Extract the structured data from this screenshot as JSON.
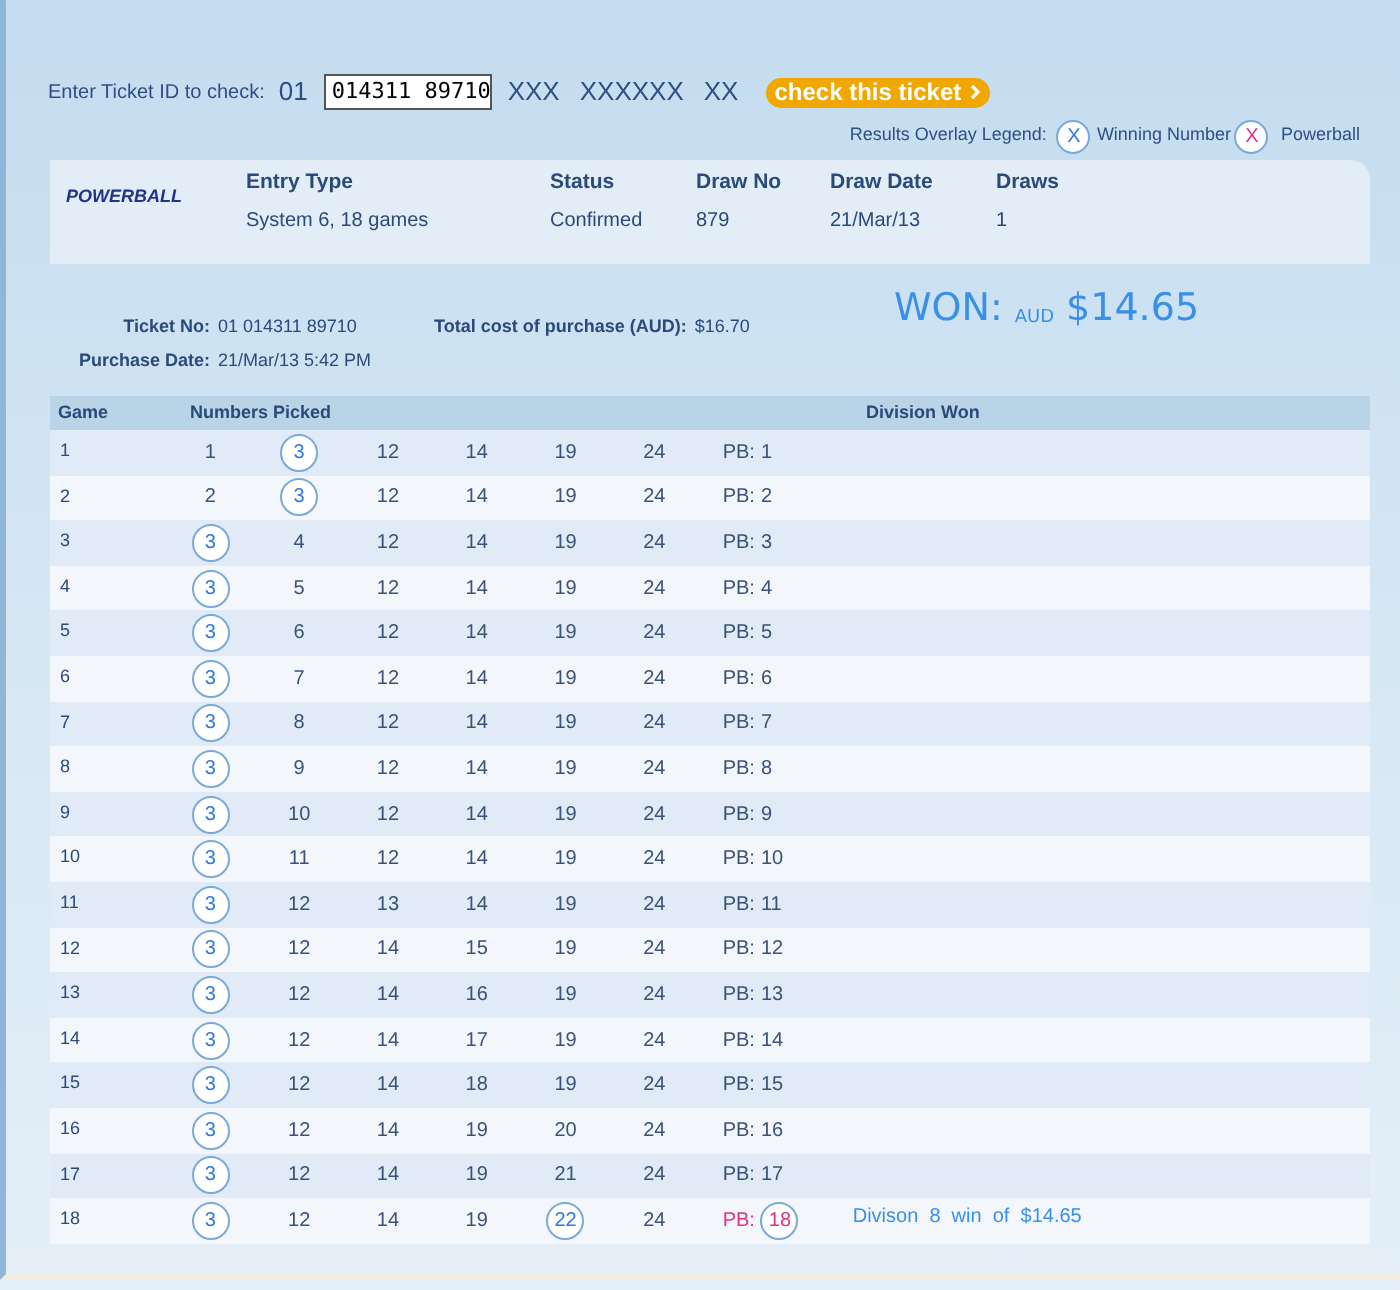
{
  "check_bar": {
    "label": "Enter Ticket ID to check:",
    "prefix": "01",
    "ticket_id": "014311 89710",
    "mask_1": "XXX",
    "mask_2": "XXXXXX",
    "mask_3": "XX",
    "button": "check this ticket"
  },
  "legend": {
    "label": "Results Overlay Legend:",
    "winning_symbol": "X",
    "winning_label": "Winning Number",
    "powerball_symbol": "X",
    "powerball_label": "Powerball"
  },
  "entry": {
    "logo": "POWERBALL",
    "fields": [
      {
        "label": "Entry Type",
        "value": "System 6, 18 games"
      },
      {
        "label": "Status",
        "value": "Confirmed"
      },
      {
        "label": "Draw No",
        "value": "879"
      },
      {
        "label": "Draw Date",
        "value": "21/Mar/13"
      },
      {
        "label": "Draws",
        "value": "1"
      }
    ]
  },
  "ticket": {
    "ticket_no_label": "Ticket No:",
    "ticket_no": "01 014311 89710",
    "purchase_date_label": "Purchase Date:",
    "purchase_date": "21/Mar/13 5:42 PM",
    "cost_label": "Total cost of purchase (AUD):",
    "cost": "$16.70",
    "won_label": "WON:",
    "won_currency": "AUD",
    "won_amount": "$14.65"
  },
  "table": {
    "columns": [
      "Game",
      "Numbers Picked",
      "Division Won"
    ],
    "rows": [
      {
        "game": "1",
        "numbers": [
          {
            "n": "1",
            "matched": false
          },
          {
            "n": "3",
            "matched": true
          },
          {
            "n": "12",
            "matched": false
          },
          {
            "n": "14",
            "matched": false
          },
          {
            "n": "19",
            "matched": false
          },
          {
            "n": "24",
            "matched": false
          }
        ],
        "pb_label": "PB:",
        "pb": "1",
        "pb_matched": false
      },
      {
        "game": "2",
        "numbers": [
          {
            "n": "2",
            "matched": false
          },
          {
            "n": "3",
            "matched": true
          },
          {
            "n": "12",
            "matched": false
          },
          {
            "n": "14",
            "matched": false
          },
          {
            "n": "19",
            "matched": false
          },
          {
            "n": "24",
            "matched": false
          }
        ],
        "pb_label": "PB:",
        "pb": "2",
        "pb_matched": false
      },
      {
        "game": "3",
        "numbers": [
          {
            "n": "3",
            "matched": true
          },
          {
            "n": "4",
            "matched": false
          },
          {
            "n": "12",
            "matched": false
          },
          {
            "n": "14",
            "matched": false
          },
          {
            "n": "19",
            "matched": false
          },
          {
            "n": "24",
            "matched": false
          }
        ],
        "pb_label": "PB:",
        "pb": "3",
        "pb_matched": false
      },
      {
        "game": "4",
        "numbers": [
          {
            "n": "3",
            "matched": true
          },
          {
            "n": "5",
            "matched": false
          },
          {
            "n": "12",
            "matched": false
          },
          {
            "n": "14",
            "matched": false
          },
          {
            "n": "19",
            "matched": false
          },
          {
            "n": "24",
            "matched": false
          }
        ],
        "pb_label": "PB:",
        "pb": "4",
        "pb_matched": false
      },
      {
        "game": "5",
        "numbers": [
          {
            "n": "3",
            "matched": true
          },
          {
            "n": "6",
            "matched": false
          },
          {
            "n": "12",
            "matched": false
          },
          {
            "n": "14",
            "matched": false
          },
          {
            "n": "19",
            "matched": false
          },
          {
            "n": "24",
            "matched": false
          }
        ],
        "pb_label": "PB:",
        "pb": "5",
        "pb_matched": false
      },
      {
        "game": "6",
        "numbers": [
          {
            "n": "3",
            "matched": true
          },
          {
            "n": "7",
            "matched": false
          },
          {
            "n": "12",
            "matched": false
          },
          {
            "n": "14",
            "matched": false
          },
          {
            "n": "19",
            "matched": false
          },
          {
            "n": "24",
            "matched": false
          }
        ],
        "pb_label": "PB:",
        "pb": "6",
        "pb_matched": false
      },
      {
        "game": "7",
        "numbers": [
          {
            "n": "3",
            "matched": true
          },
          {
            "n": "8",
            "matched": false
          },
          {
            "n": "12",
            "matched": false
          },
          {
            "n": "14",
            "matched": false
          },
          {
            "n": "19",
            "matched": false
          },
          {
            "n": "24",
            "matched": false
          }
        ],
        "pb_label": "PB:",
        "pb": "7",
        "pb_matched": false
      },
      {
        "game": "8",
        "numbers": [
          {
            "n": "3",
            "matched": true
          },
          {
            "n": "9",
            "matched": false
          },
          {
            "n": "12",
            "matched": false
          },
          {
            "n": "14",
            "matched": false
          },
          {
            "n": "19",
            "matched": false
          },
          {
            "n": "24",
            "matched": false
          }
        ],
        "pb_label": "PB:",
        "pb": "8",
        "pb_matched": false
      },
      {
        "game": "9",
        "numbers": [
          {
            "n": "3",
            "matched": true
          },
          {
            "n": "10",
            "matched": false
          },
          {
            "n": "12",
            "matched": false
          },
          {
            "n": "14",
            "matched": false
          },
          {
            "n": "19",
            "matched": false
          },
          {
            "n": "24",
            "matched": false
          }
        ],
        "pb_label": "PB:",
        "pb": "9",
        "pb_matched": false
      },
      {
        "game": "10",
        "numbers": [
          {
            "n": "3",
            "matched": true
          },
          {
            "n": "11",
            "matched": false
          },
          {
            "n": "12",
            "matched": false
          },
          {
            "n": "14",
            "matched": false
          },
          {
            "n": "19",
            "matched": false
          },
          {
            "n": "24",
            "matched": false
          }
        ],
        "pb_label": "PB:",
        "pb": "10",
        "pb_matched": false
      },
      {
        "game": "11",
        "numbers": [
          {
            "n": "3",
            "matched": true
          },
          {
            "n": "12",
            "matched": false
          },
          {
            "n": "13",
            "matched": false
          },
          {
            "n": "14",
            "matched": false
          },
          {
            "n": "19",
            "matched": false
          },
          {
            "n": "24",
            "matched": false
          }
        ],
        "pb_label": "PB:",
        "pb": "11",
        "pb_matched": false
      },
      {
        "game": "12",
        "numbers": [
          {
            "n": "3",
            "matched": true
          },
          {
            "n": "12",
            "matched": false
          },
          {
            "n": "14",
            "matched": false
          },
          {
            "n": "15",
            "matched": false
          },
          {
            "n": "19",
            "matched": false
          },
          {
            "n": "24",
            "matched": false
          }
        ],
        "pb_label": "PB:",
        "pb": "12",
        "pb_matched": false
      },
      {
        "game": "13",
        "numbers": [
          {
            "n": "3",
            "matched": true
          },
          {
            "n": "12",
            "matched": false
          },
          {
            "n": "14",
            "matched": false
          },
          {
            "n": "16",
            "matched": false
          },
          {
            "n": "19",
            "matched": false
          },
          {
            "n": "24",
            "matched": false
          }
        ],
        "pb_label": "PB:",
        "pb": "13",
        "pb_matched": false
      },
      {
        "game": "14",
        "numbers": [
          {
            "n": "3",
            "matched": true
          },
          {
            "n": "12",
            "matched": false
          },
          {
            "n": "14",
            "matched": false
          },
          {
            "n": "17",
            "matched": false
          },
          {
            "n": "19",
            "matched": false
          },
          {
            "n": "24",
            "matched": false
          }
        ],
        "pb_label": "PB:",
        "pb": "14",
        "pb_matched": false
      },
      {
        "game": "15",
        "numbers": [
          {
            "n": "3",
            "matched": true
          },
          {
            "n": "12",
            "matched": false
          },
          {
            "n": "14",
            "matched": false
          },
          {
            "n": "18",
            "matched": false
          },
          {
            "n": "19",
            "matched": false
          },
          {
            "n": "24",
            "matched": false
          }
        ],
        "pb_label": "PB:",
        "pb": "15",
        "pb_matched": false
      },
      {
        "game": "16",
        "numbers": [
          {
            "n": "3",
            "matched": true
          },
          {
            "n": "12",
            "matched": false
          },
          {
            "n": "14",
            "matched": false
          },
          {
            "n": "19",
            "matched": false
          },
          {
            "n": "20",
            "matched": false
          },
          {
            "n": "24",
            "matched": false
          }
        ],
        "pb_label": "PB:",
        "pb": "16",
        "pb_matched": false
      },
      {
        "game": "17",
        "numbers": [
          {
            "n": "3",
            "matched": true
          },
          {
            "n": "12",
            "matched": false
          },
          {
            "n": "14",
            "matched": false
          },
          {
            "n": "19",
            "matched": false
          },
          {
            "n": "21",
            "matched": false
          },
          {
            "n": "24",
            "matched": false
          }
        ],
        "pb_label": "PB:",
        "pb": "17",
        "pb_matched": false
      },
      {
        "game": "18",
        "numbers": [
          {
            "n": "3",
            "matched": true
          },
          {
            "n": "12",
            "matched": false
          },
          {
            "n": "14",
            "matched": false
          },
          {
            "n": "19",
            "matched": false
          },
          {
            "n": "22",
            "matched": true
          },
          {
            "n": "24",
            "matched": false
          }
        ],
        "pb_label": "PB:",
        "pb": "18",
        "pb_matched": true,
        "division": "Divison  8  win  of  $14.65"
      }
    ]
  }
}
